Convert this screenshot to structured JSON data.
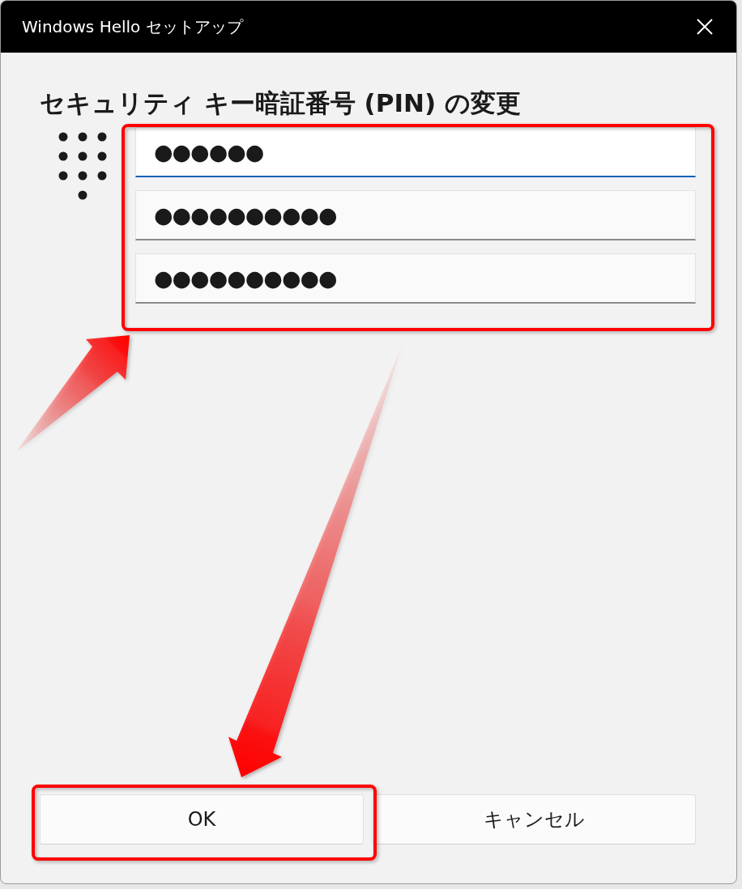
{
  "window": {
    "title": "Windows Hello セットアップ"
  },
  "heading": "セキュリティ キー暗証番号 (PIN) の変更",
  "pin_fields": [
    {
      "value": "●●●●●●",
      "focused": true
    },
    {
      "value": "●●●●●●●●●●",
      "focused": false
    },
    {
      "value": "●●●●●●●●●●",
      "focused": false
    }
  ],
  "buttons": [
    "OK",
    "キャンセル"
  ]
}
